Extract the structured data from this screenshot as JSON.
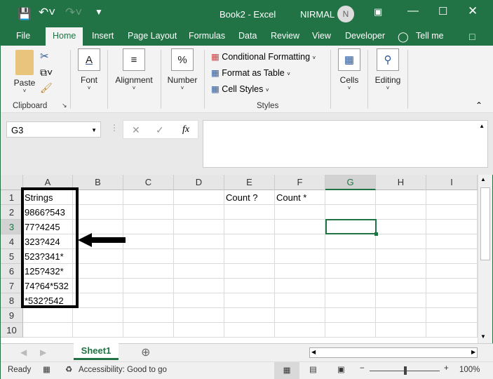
{
  "window": {
    "title": "Book2  -  Excel",
    "user": "NIRMAL",
    "avatar_initial": "N"
  },
  "menu_tabs": [
    "File",
    "Home",
    "Insert",
    "Page Layout",
    "Formulas",
    "Data",
    "Review",
    "View",
    "Developer",
    "Tell me"
  ],
  "ribbon": {
    "paste": "Paste",
    "clipboard": "Clipboard",
    "font": "Font",
    "alignment": "Alignment",
    "number": "Number",
    "conditional": "Conditional Formatting",
    "format_table": "Format as Table",
    "cell_styles": "Cell Styles",
    "styles": "Styles",
    "cells": "Cells",
    "editing": "Editing"
  },
  "formula_bar": {
    "name_box": "G3",
    "fx": "fx",
    "value": ""
  },
  "columns": [
    "A",
    "B",
    "C",
    "D",
    "E",
    "F",
    "G",
    "H",
    "I"
  ],
  "rows": [
    "1",
    "2",
    "3",
    "4",
    "5",
    "6",
    "7",
    "8",
    "9",
    "10"
  ],
  "cells": {
    "A1": "Strings",
    "A2": "9866?543",
    "A3": "77?4245",
    "A4": "323?424",
    "A5": "523?341*",
    "A6": "125?432*",
    "A7": "74?64*532",
    "A8": "*532?542",
    "E1": "Count ?",
    "F1": "Count *"
  },
  "selected_cell": "G3",
  "sheet_tabs": [
    "Sheet1"
  ],
  "status": {
    "ready": "Ready",
    "accessibility": "Accessibility: Good to go",
    "zoom": "100%"
  },
  "colors": {
    "accent": "#217346"
  }
}
